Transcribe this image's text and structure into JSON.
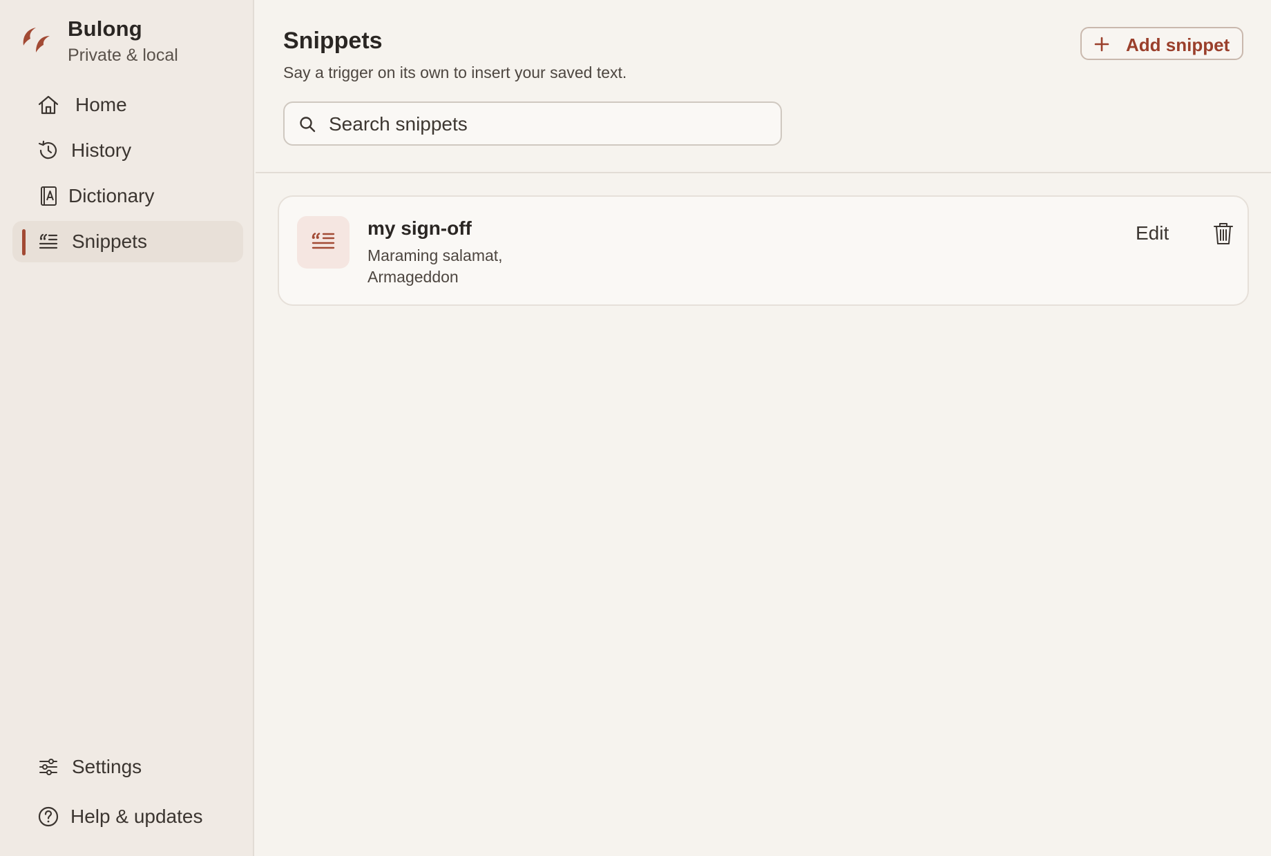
{
  "app": {
    "name": "Bulong",
    "tagline": "Private & local"
  },
  "sidebar": {
    "items": [
      {
        "label": "Home",
        "icon": "home-icon"
      },
      {
        "label": "History",
        "icon": "history-icon"
      },
      {
        "label": "Dictionary",
        "icon": "dictionary-icon"
      },
      {
        "label": "Snippets",
        "icon": "snippets-icon",
        "active": true
      }
    ],
    "footer": [
      {
        "label": "Settings",
        "icon": "sliders-icon"
      },
      {
        "label": "Help & updates",
        "icon": "help-icon"
      }
    ]
  },
  "header": {
    "title": "Snippets",
    "description": "Say a trigger on its own to insert your saved text.",
    "add_label": "Add snippet"
  },
  "search": {
    "placeholder": "Search snippets",
    "value": ""
  },
  "snippets": [
    {
      "trigger": "my sign-off",
      "expansion": "Maraming salamat,\nArmageddon",
      "edit_label": "Edit",
      "icon": "quote-lines-icon"
    }
  ],
  "colors": {
    "accent": "#a24a34",
    "sidebar_bg": "#f0eae4",
    "main_bg": "#f6f3ee",
    "active_item_bg": "#e8e0d8"
  }
}
